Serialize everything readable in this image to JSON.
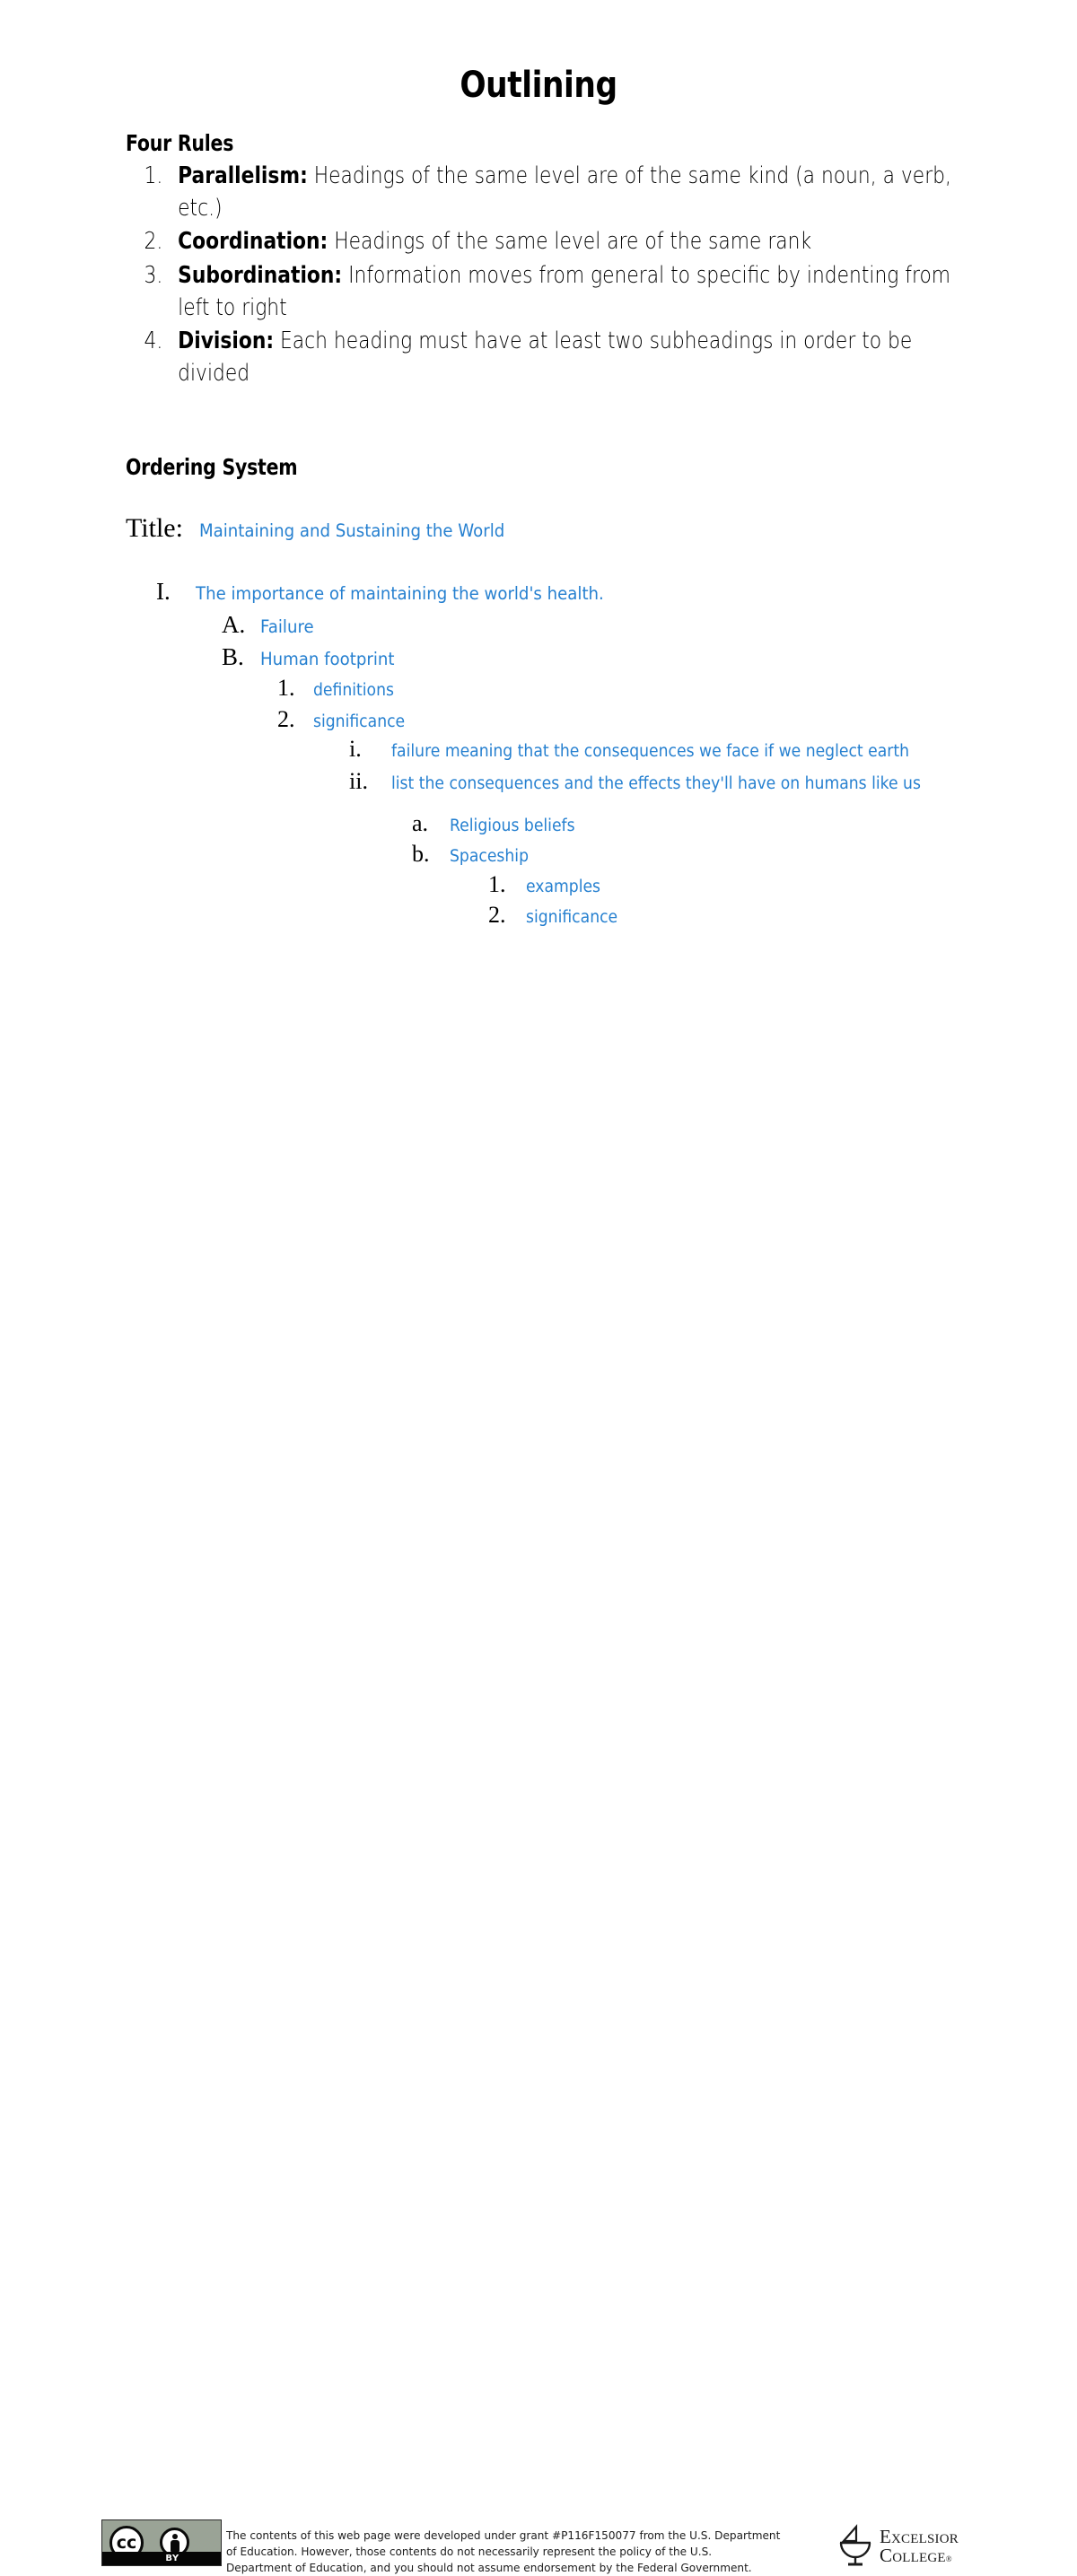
{
  "document": {
    "title": "Outlining"
  },
  "four_rules": {
    "heading": "Four Rules",
    "items": [
      {
        "marker": "1.",
        "term": "Parallelism:",
        "text": " Headings of the same level are of the same kind (a noun, a verb, etc.)"
      },
      {
        "marker": "2.",
        "term": "Coordination:",
        "text": " Headings of the same level are of the same rank"
      },
      {
        "marker": "3.",
        "term": "Subordination:",
        "text": " Information moves from general to specific by indenting from left to right"
      },
      {
        "marker": "4.",
        "term": "Division:",
        "text": " Each heading must have at least two subheadings in order to be divided"
      }
    ]
  },
  "ordering_system": {
    "heading": "Ordering System",
    "title_label": "Title:",
    "title_value": "Maintaining and Sustaining the World",
    "accent_color": "#2680d0",
    "outline": [
      {
        "marker": "I.",
        "text": "The importance of maintaining the world's health."
      },
      {
        "marker": "A.",
        "text": "Failure"
      },
      {
        "marker": "B.",
        "text": "Human footprint"
      },
      {
        "marker": "1.",
        "text": "definitions"
      },
      {
        "marker": "2.",
        "text": "significance"
      },
      {
        "marker": "i.",
        "text": "failure meaning that the consequences we face if we neglect earth"
      },
      {
        "marker": "ii.",
        "text": "list the consequences and the effects they'll have on humans like us"
      },
      {
        "marker": "a.",
        "text": "Religious beliefs"
      },
      {
        "marker": "b.",
        "text": "Spaceship"
      },
      {
        "marker": "1.",
        "text": "examples"
      },
      {
        "marker": "2.",
        "text": "significance"
      }
    ]
  },
  "footer": {
    "cc_license": {
      "cc_glyph": "cc",
      "by_label": "BY"
    },
    "disclaimer_lines": [
      "The contents of this web page were developed under grant #P116F150077 from the U.S. Department",
      "of Education. However, those contents do not necessarily represent the policy of the U.S.",
      "Department of Education, and you should not assume endorsement by the Federal Government."
    ],
    "logo": {
      "line1": "Excelsior",
      "line2": "College",
      "registered": "®"
    }
  }
}
